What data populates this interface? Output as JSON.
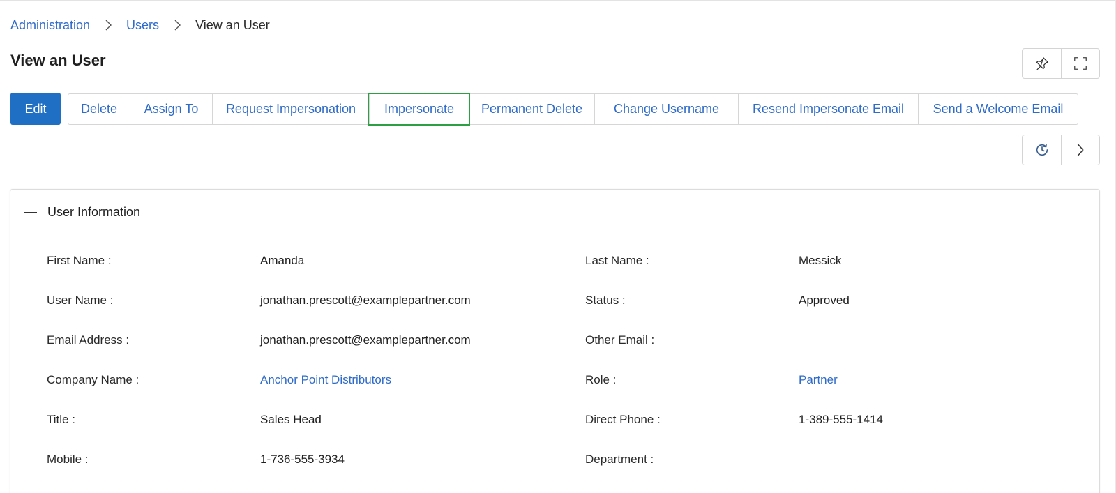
{
  "breadcrumb": {
    "items": [
      "Administration",
      "Users",
      "View an User"
    ]
  },
  "page": {
    "title": "View an User"
  },
  "toolbar": {
    "edit_label": "Edit",
    "actions": [
      "Delete",
      "Assign To",
      "Request Impersonation",
      "Impersonate",
      "Permanent Delete",
      "Change Username",
      "Resend Impersonate Email",
      "Send a Welcome Email"
    ],
    "highlighted_action": "Impersonate"
  },
  "icons": {
    "pin": "pin-icon",
    "fullscreen": "fullscreen-icon",
    "history": "history-icon",
    "next": "chevron-right-icon"
  },
  "section": {
    "title": "User Information",
    "left_fields": [
      {
        "label": "First Name :",
        "value": "Amanda",
        "is_link": false
      },
      {
        "label": "User Name :",
        "value": "jonathan.prescott@examplepartner.com",
        "is_link": false
      },
      {
        "label": "Email Address :",
        "value": "jonathan.prescott@examplepartner.com",
        "is_link": false
      },
      {
        "label": "Company Name :",
        "value": "Anchor Point Distributors",
        "is_link": true
      },
      {
        "label": "Title :",
        "value": "Sales Head",
        "is_link": false
      },
      {
        "label": "Mobile :",
        "value": "1-736-555-3934",
        "is_link": false
      }
    ],
    "right_fields": [
      {
        "label": "Last Name :",
        "value": "Messick",
        "is_link": false
      },
      {
        "label": "Status :",
        "value": "Approved",
        "is_link": false
      },
      {
        "label": "Other Email :",
        "value": "",
        "is_link": false
      },
      {
        "label": "Role :",
        "value": "Partner",
        "is_link": true
      },
      {
        "label": "Direct Phone :",
        "value": "1-389-555-1414",
        "is_link": false
      },
      {
        "label": "Department :",
        "value": "",
        "is_link": false
      }
    ]
  },
  "colors": {
    "primary": "#1f6fc5",
    "link": "#2f6bc8",
    "highlight_outline": "#2ea043"
  }
}
